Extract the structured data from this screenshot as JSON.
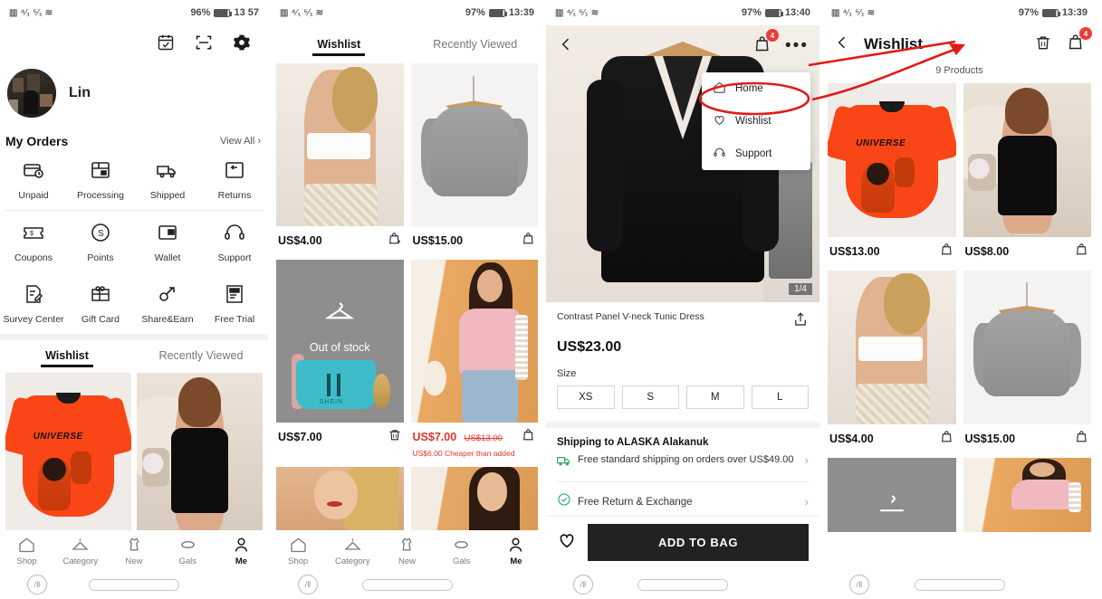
{
  "panel1": {
    "status": {
      "battery": "96%",
      "time": "13 57"
    },
    "top_icons": [
      "calendar-check-icon",
      "scan-icon",
      "gear-icon"
    ],
    "user_name": "Lin",
    "orders_title": "My Orders",
    "view_all": "View All",
    "order_items": [
      {
        "label": "Unpaid",
        "icon": "unpaid-icon"
      },
      {
        "label": "Processing",
        "icon": "processing-icon"
      },
      {
        "label": "Shipped",
        "icon": "shipped-icon"
      },
      {
        "label": "Returns",
        "icon": "returns-icon"
      }
    ],
    "service_items": [
      {
        "label": "Coupons",
        "icon": "coupon-icon"
      },
      {
        "label": "Points",
        "icon": "points-icon"
      },
      {
        "label": "Wallet",
        "icon": "wallet-icon"
      },
      {
        "label": "Support",
        "icon": "support-icon"
      },
      {
        "label": "Survey Center",
        "icon": "survey-icon"
      },
      {
        "label": "Gift Card",
        "icon": "giftcard-icon"
      },
      {
        "label": "Share&Earn",
        "icon": "share-icon"
      },
      {
        "label": "Free Trial",
        "icon": "freetrial-icon"
      }
    ],
    "tabs": [
      {
        "label": "Wishlist",
        "active": true
      },
      {
        "label": "Recently Viewed",
        "active": false
      }
    ],
    "bottom_nav": [
      {
        "label": "Shop",
        "active": false
      },
      {
        "label": "Category",
        "active": false
      },
      {
        "label": "New",
        "active": false
      },
      {
        "label": "Gals",
        "active": false
      },
      {
        "label": "Me",
        "active": true
      }
    ]
  },
  "panel2": {
    "status": {
      "battery": "97%",
      "time": "13:39"
    },
    "tabs": [
      {
        "label": "Wishlist",
        "active": true
      },
      {
        "label": "Recently Viewed",
        "active": false
      }
    ],
    "products": [
      {
        "price": "US$4.00",
        "action": "add-to-bag-icon"
      },
      {
        "price": "US$15.00",
        "action": "add-to-bag-icon"
      },
      {
        "price": "US$7.00",
        "action": "delete-icon",
        "badge": "Out of stock"
      },
      {
        "price": "US$7.00",
        "old_price": "US$13.00",
        "note": "US$6.00 Cheaper than added",
        "action": "add-to-bag-icon",
        "sale": true
      }
    ],
    "bottom_nav": [
      {
        "label": "Shop",
        "active": false
      },
      {
        "label": "Category",
        "active": false
      },
      {
        "label": "New",
        "active": false
      },
      {
        "label": "Gals",
        "active": false
      },
      {
        "label": "Me",
        "active": true
      }
    ]
  },
  "panel3": {
    "status": {
      "battery": "97%",
      "time": "13:40"
    },
    "bag_badge": "4",
    "image_counter": "1/4",
    "dropdown": [
      {
        "label": "Home",
        "icon": "home-icon",
        "highlighted": false
      },
      {
        "label": "Wishlist",
        "icon": "heart-icon",
        "highlighted": true
      },
      {
        "label": "Support",
        "icon": "headset-icon",
        "highlighted": false
      }
    ],
    "product_name": "Contrast Panel V-neck Tunic Dress",
    "price": "US$23.00",
    "size_label": "Size",
    "sizes": [
      "XS",
      "S",
      "M",
      "L"
    ],
    "shipping_title": "Shipping to ALASKA Alakanuk",
    "shipping_text": "Free standard shipping on orders over US$49.00",
    "return_text": "Free Return & Exchange",
    "cta_label": "ADD TO BAG"
  },
  "panel4": {
    "status": {
      "battery": "97%",
      "time": "13:39"
    },
    "title": "Wishlist",
    "bag_badge": "4",
    "product_count": "9 Products",
    "icons": [
      "back-arrow-icon",
      "trash-icon",
      "bag-icon"
    ],
    "products": [
      {
        "price": "US$13.00"
      },
      {
        "price": "US$8.00"
      },
      {
        "price": "US$4.00"
      },
      {
        "price": "US$15.00"
      }
    ]
  },
  "colors": {
    "accent_red": "#e8322a",
    "badge_red": "#ef3b39",
    "cta_black": "#222222",
    "annotation_red": "#e01b18"
  }
}
